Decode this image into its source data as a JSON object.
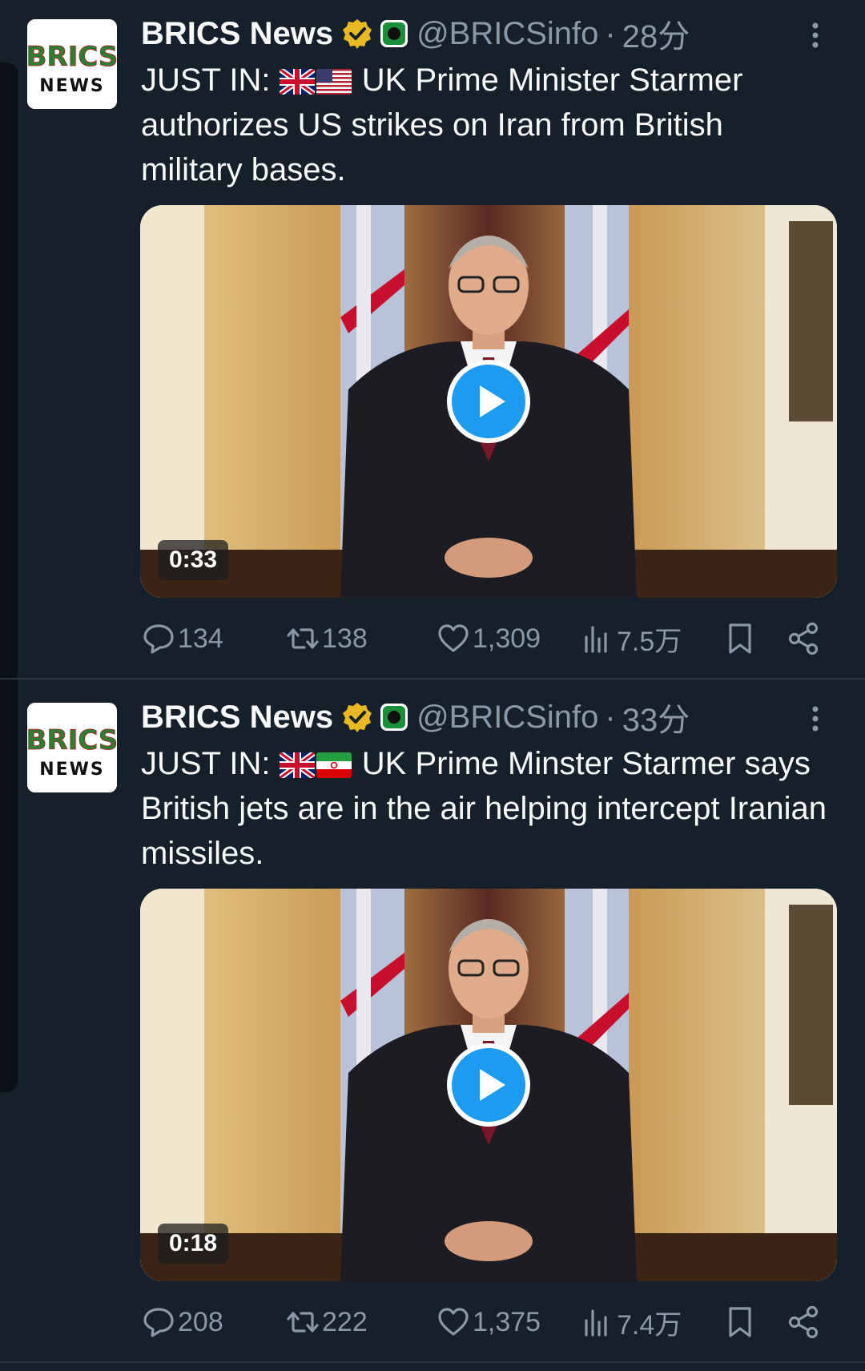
{
  "colors": {
    "background": "#15202b",
    "text_primary": "#f7f9f9",
    "text_secondary": "#8b98a5",
    "verified_gold": "#e8b923",
    "play_blue": "#1d9bf0",
    "divider": "#2a3743"
  },
  "tweets": [
    {
      "author": {
        "name": "BRICS News",
        "handle": "@BRICSinfo",
        "avatar_text_top": "BRICS",
        "avatar_text_bottom": "NEWS",
        "verified_icon": "gold-check-badge-icon",
        "affiliate_icon": "green-affiliate-badge-icon"
      },
      "separator": "·",
      "time": "28分",
      "text_prefix": "JUST IN:",
      "flags": [
        "uk-flag-icon",
        "us-flag-icon"
      ],
      "text_body": "UK Prime Minister Starmer authorizes US strikes on Iran from British military bases.",
      "media": {
        "type": "video",
        "duration": "0:33",
        "play_icon": "play-icon"
      },
      "stats": {
        "replies": "134",
        "reposts": "138",
        "likes": "1,309",
        "views": "7.5万"
      }
    },
    {
      "author": {
        "name": "BRICS News",
        "handle": "@BRICSinfo",
        "avatar_text_top": "BRICS",
        "avatar_text_bottom": "NEWS",
        "verified_icon": "gold-check-badge-icon",
        "affiliate_icon": "green-affiliate-badge-icon"
      },
      "separator": "·",
      "time": "33分",
      "text_prefix": "JUST IN:",
      "flags": [
        "uk-flag-icon",
        "iran-flag-icon"
      ],
      "text_body": "UK Prime Minster Starmer says British jets are in the air helping intercept Iranian missiles.",
      "media": {
        "type": "video",
        "duration": "0:18",
        "play_icon": "play-icon"
      },
      "stats": {
        "replies": "208",
        "reposts": "222",
        "likes": "1,375",
        "views": "7.4万"
      }
    }
  ]
}
